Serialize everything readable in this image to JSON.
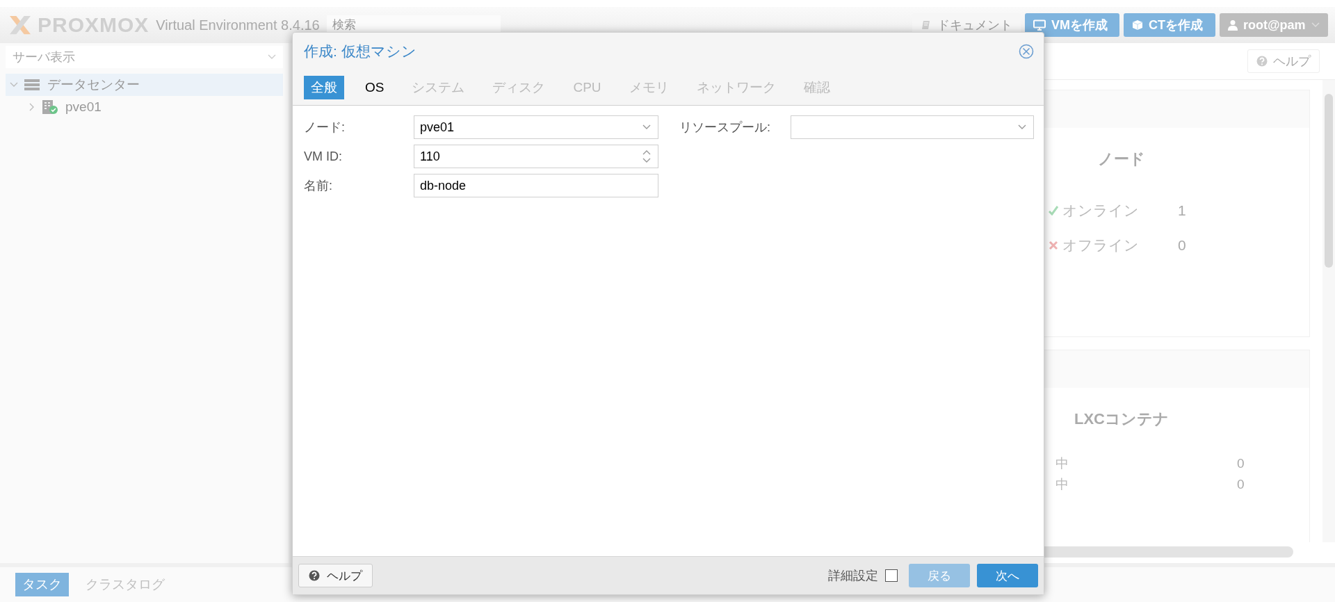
{
  "header": {
    "logo": "PROXMOX",
    "version": "Virtual Environment 8.4.16",
    "search": {
      "placeholder": "検索"
    },
    "buttons": [
      {
        "kind": "docs",
        "label": "ドキュメント"
      },
      {
        "kind": "vm",
        "label": "VMを作成"
      },
      {
        "kind": "ct",
        "label": "CTを作成"
      },
      {
        "kind": "user",
        "label": "root@pam"
      }
    ]
  },
  "sidebar": {
    "view_select": {
      "placeholder": "サーバ表示"
    },
    "tree": [
      {
        "label": "データセンター",
        "kind": "datacenter",
        "selected": true,
        "expanded": true,
        "children": [
          {
            "label": "pve01",
            "kind": "node",
            "selected": false,
            "expanded": false
          }
        ]
      }
    ]
  },
  "content": {
    "help_button": "ヘルプ",
    "panels": [
      {
        "title": "ノード",
        "rows": [
          {
            "kind": "online",
            "label": "オンライン",
            "value": "1"
          },
          {
            "kind": "offline",
            "label": "オフライン",
            "value": "0"
          }
        ]
      },
      {
        "title": "LXCコンテナ",
        "rows": [
          {
            "kind": "plain",
            "label": "中",
            "value": "0"
          },
          {
            "kind": "plain",
            "label": "中",
            "value": "0"
          }
        ]
      }
    ]
  },
  "bottom_tabs": [
    {
      "label": "タスク",
      "selected": true
    },
    {
      "label": "クラスタログ",
      "selected": false
    }
  ],
  "dialog": {
    "title": "作成: 仮想マシン",
    "tabs": [
      {
        "label": "全般",
        "selected": true,
        "disabled": false
      },
      {
        "label": "OS",
        "selected": false,
        "disabled": false
      },
      {
        "label": "システム",
        "selected": false,
        "disabled": true
      },
      {
        "label": "ディスク",
        "selected": false,
        "disabled": true
      },
      {
        "label": "CPU",
        "selected": false,
        "disabled": true
      },
      {
        "label": "メモリ",
        "selected": false,
        "disabled": true
      },
      {
        "label": "ネットワーク",
        "selected": false,
        "disabled": true
      },
      {
        "label": "確認",
        "selected": false,
        "disabled": true
      }
    ],
    "left_fields": [
      {
        "label": "ノード:",
        "kind": "select",
        "value": "pve01"
      },
      {
        "label": "VM ID:",
        "kind": "spinner",
        "value": "110"
      },
      {
        "label": "名前:",
        "kind": "text",
        "value": "db-node"
      }
    ],
    "right_fields": [
      {
        "label": "リソースプール:",
        "kind": "select"
      }
    ],
    "footer": {
      "help": "ヘルプ",
      "advanced": {
        "label": "詳細設定",
        "checked": false
      },
      "back": {
        "label": "戻る",
        "disabled": true
      },
      "next": {
        "label": "次へ",
        "disabled": false
      }
    }
  }
}
